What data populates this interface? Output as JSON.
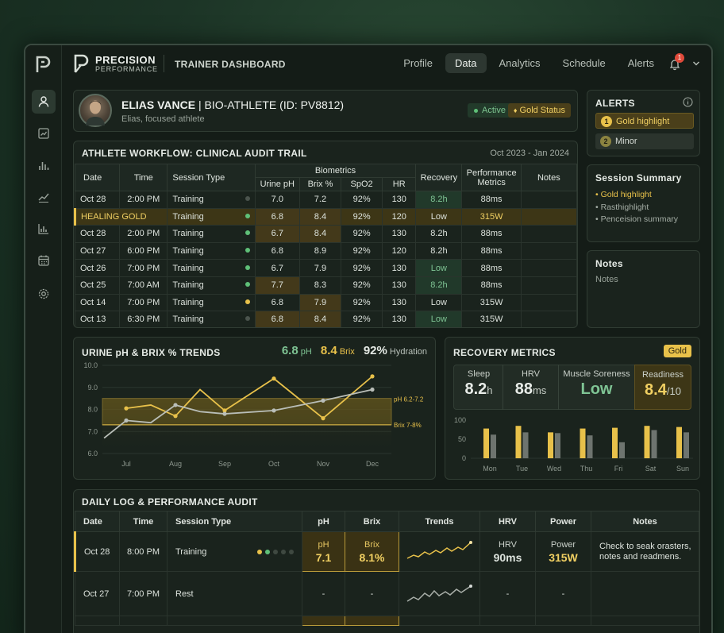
{
  "brand": {
    "name": "PRECISION",
    "sub": "PERFORMANCE",
    "section": "TRAINER DASHBOARD"
  },
  "nav": [
    "Profile",
    "Data",
    "Analytics",
    "Schedule",
    "Alerts"
  ],
  "notifications_count": "1",
  "profile": {
    "name": "ELIAS VANCE",
    "title": "| BIO-ATHLETE (ID: PV8812)",
    "subtitle": "Elias, focused athlete",
    "status": "Active",
    "tier": "Gold Status"
  },
  "workflow": {
    "title": "ATHLETE WORKFLOW: CLINICAL AUDIT TRAIL",
    "range": "Oct 2023 - Jan 2024",
    "headers": {
      "date": "Date",
      "time": "Time",
      "session": "Session Type",
      "biometrics": "Biometrics",
      "ph": "Urine pH",
      "brix": "Brix %",
      "spo2": "SpO2",
      "hr": "HR",
      "recovery": "Recovery",
      "perf": "Performance Metrics",
      "notes": "Notes"
    },
    "rows": [
      {
        "date": "Oct 28",
        "time": "2:00 PM",
        "session": "Training",
        "ph": "7.0",
        "brix": "7.2",
        "spo2": "92%",
        "hr": "130",
        "recovery": "8.2h",
        "perf": "88ms"
      },
      {
        "date": "HEALING GOLD",
        "time": "",
        "session": "Training",
        "ph": "6.8",
        "brix": "8.4",
        "spo2": "92%",
        "hr": "120",
        "recovery": "Low",
        "perf": "315W"
      },
      {
        "date": "Oct 28",
        "time": "2:00 PM",
        "session": "Training",
        "ph": "6.7",
        "brix": "8.4",
        "spo2": "92%",
        "hr": "130",
        "recovery": "8.2h",
        "perf": "88ms"
      },
      {
        "date": "Oct 27",
        "time": "6:00 PM",
        "session": "Training",
        "ph": "6.8",
        "brix": "8.9",
        "spo2": "92%",
        "hr": "120",
        "recovery": "8.2h",
        "perf": "88ms"
      },
      {
        "date": "Oct 26",
        "time": "7:00 PM",
        "session": "Training",
        "ph": "6.7",
        "brix": "7.9",
        "spo2": "92%",
        "hr": "130",
        "recovery": "Low",
        "perf": "88ms"
      },
      {
        "date": "Oct 25",
        "time": "7:00 AM",
        "session": "Training",
        "ph": "7.7",
        "brix": "8.3",
        "spo2": "92%",
        "hr": "130",
        "recovery": "8.2h",
        "perf": "88ms"
      },
      {
        "date": "Oct 14",
        "time": "7:00 PM",
        "session": "Training",
        "ph": "6.8",
        "brix": "7.9",
        "spo2": "92%",
        "hr": "130",
        "recovery": "Low",
        "perf": "315W"
      },
      {
        "date": "Oct 13",
        "time": "6:30 PM",
        "session": "Training",
        "ph": "6.8",
        "brix": "8.4",
        "spo2": "92%",
        "hr": "130",
        "recovery": "Low",
        "perf": "315W"
      }
    ]
  },
  "alerts": {
    "title": "ALERTS",
    "items": [
      {
        "num": "1",
        "label": "Gold highlight"
      },
      {
        "num": "2",
        "label": "Minor"
      }
    ]
  },
  "session_summary": {
    "title": "Session Summary",
    "items": [
      "Gold highlight",
      "Rasthighlight",
      "Penceision summary"
    ]
  },
  "notes_panel": {
    "title": "Notes",
    "body": "Notes"
  },
  "trends": {
    "title": "URINE pH & BRIX % TRENDS",
    "ph_value": "6.8",
    "ph_unit": "pH",
    "brix_value": "8.4",
    "brix_unit": "Brix",
    "hydration_value": "92%",
    "hydration_unit": "Hydration",
    "band_ph": "pH 6.2-7.2",
    "band_brix": "Brix 7-8%"
  },
  "recovery": {
    "title": "RECOVERY METRICS",
    "badge": "Gold",
    "sleep_label": "Sleep",
    "sleep_value": "8.2",
    "sleep_unit": "h",
    "hrv_label": "HRV",
    "hrv_value": "88",
    "hrv_unit": "ms",
    "soreness_label": "Muscle Soreness",
    "soreness_value": "Low",
    "readiness_label": "Readiness",
    "readiness_value": "8.4",
    "readiness_unit": "/10"
  },
  "chart_data": [
    {
      "type": "line",
      "title": "URINE pH & BRIX % TRENDS",
      "x": [
        "Jul",
        "Aug",
        "Sep",
        "Oct",
        "Nov",
        "Dec"
      ],
      "ylim": [
        6.0,
        10.0
      ],
      "yticks": [
        "10.0",
        "9.0",
        "8.0",
        "7.0",
        "6.0"
      ],
      "bands": [
        {
          "name": "pH 6.2-7.2",
          "range": [
            7.0,
            8.5
          ]
        },
        {
          "name": "Brix 7-8%",
          "range": [
            7.3,
            8.5
          ]
        }
      ],
      "series": [
        {
          "color": "#e8c14a",
          "points": [
            [
              0,
              8.05
            ],
            [
              0.5,
              8.2
            ],
            [
              1,
              7.7
            ],
            [
              1.5,
              8.9
            ],
            [
              2,
              7.95
            ],
            [
              3,
              9.4
            ],
            [
              4,
              7.6
            ],
            [
              5,
              9.5
            ]
          ]
        },
        {
          "color": "#b9beb8",
          "points": [
            [
              -0.45,
              6.7
            ],
            [
              0,
              7.5
            ],
            [
              0.5,
              7.4
            ],
            [
              1,
              8.2
            ],
            [
              1.5,
              7.9
            ],
            [
              2,
              7.8
            ],
            [
              3,
              7.95
            ],
            [
              4,
              8.4
            ],
            [
              5,
              8.9
            ]
          ]
        }
      ]
    },
    {
      "type": "bar",
      "categories": [
        "Mon",
        "Tue",
        "Wed",
        "Thu",
        "Fri",
        "Sat",
        "Sun"
      ],
      "yticks": [
        "100",
        "50",
        "0"
      ],
      "ylim": [
        0,
        100
      ],
      "series": [
        {
          "color": "#e8c14a",
          "values": [
            78,
            85,
            68,
            78,
            80,
            85,
            82
          ]
        },
        {
          "color": "#6e746f",
          "values": [
            62,
            68,
            66,
            60,
            42,
            74,
            68
          ]
        }
      ]
    }
  ],
  "daily": {
    "title": "DAILY LOG & PERFORMANCE AUDIT",
    "headers": [
      "Date",
      "Time",
      "Session Type",
      "pH",
      "Brix",
      "Trends",
      "HRV",
      "Power",
      "Notes"
    ],
    "rows": [
      {
        "date": "Oct 28",
        "time": "8:00 PM",
        "session": "Training",
        "ph_label": "pH",
        "ph": "7.1",
        "brix_label": "Brix",
        "brix": "8.1%",
        "hrv_label": "HRV",
        "hrv": "90ms",
        "power_label": "Power",
        "power": "315W",
        "notes": "Check to seak orasters, notes and readmens."
      },
      {
        "date": "Oct 27",
        "time": "7:00 PM",
        "session": "Rest",
        "ph": "-",
        "brix": "-",
        "hrv": "-",
        "power": "-",
        "notes": ""
      }
    ]
  },
  "colors": {
    "gold": "#e8c14a",
    "green": "#5fc078",
    "bg": "#141c17",
    "panel": "#1a231d"
  }
}
